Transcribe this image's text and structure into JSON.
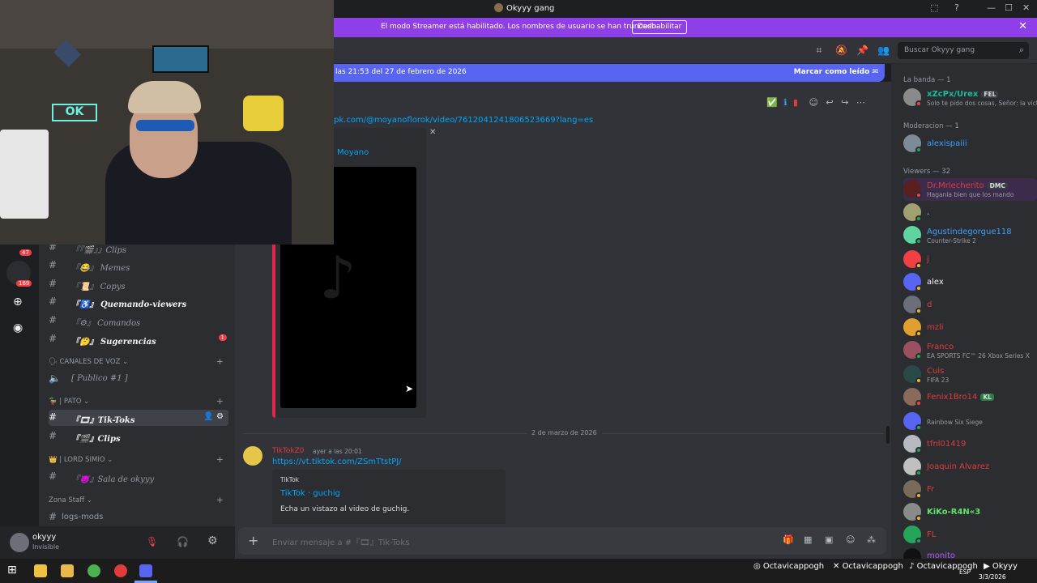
{
  "window": {
    "title": "Okyyy gang",
    "minimize": "—",
    "maximize": "☐",
    "close": "✕"
  },
  "banner": {
    "text": "El modo Streamer está habilitado. Los nombres de usuario se han truncado.",
    "button": "Deshabilitar",
    "accent": "#8f3fe8"
  },
  "search": {
    "placeholder": "Buscar Okyyy gang"
  },
  "new_messages": {
    "text": "las 21:53 del 27 de febrero de 2026",
    "mark_read": "Marcar como leído"
  },
  "messages": {
    "first": {
      "link": "pk.com/@moyanoflorok/video/7612041241806523669?lang=es",
      "embed_author": "Moyano"
    },
    "date_divider": "2 de marzo de 2026",
    "second": {
      "author": "TikTokZ0",
      "time": "ayer a las 20:01",
      "link": "https://vt.tiktok.com/ZSmTtstPJ/",
      "embed_provider": "TikTok",
      "embed_title": "TikTok · guchig",
      "embed_desc": "Echa un vistazo al video de guchig."
    }
  },
  "servers": {
    "badge1": "47",
    "badge2": "169"
  },
  "channels": {
    "items": [
      {
        "name": "Clips",
        "bracket": "『🎬』",
        "bold": false
      },
      {
        "name": "Memes",
        "bracket": "『😂』",
        "bold": false
      },
      {
        "name": "Copys",
        "bracket": "『📜』",
        "bold": false
      },
      {
        "name": "Quemando-viewers",
        "bracket": "『♿』",
        "bold": true
      },
      {
        "name": "Comandos",
        "bracket": "『⚙』",
        "bold": false
      },
      {
        "name": "Sugerencias",
        "bracket": "『🤔』",
        "bold": true,
        "badge": "1"
      }
    ],
    "voice_category": "CANALES DE VOZ",
    "voice_item": "[ Publico #1 ]",
    "pato_category": "PATO",
    "pato_items": [
      "Tik-Toks",
      "Clips"
    ],
    "simio_category": "LORD SIMIO",
    "simio_item": "Sala de okyyy",
    "staff_category": "Zona Staff",
    "staff_item": "logs-mods"
  },
  "user": {
    "name": "okyyy",
    "status": "Invisible"
  },
  "composer": {
    "placeholder": "Enviar mensaje a #『🎞』Tik-Toks"
  },
  "members": {
    "groups": [
      {
        "title": "La banda — 1"
      },
      {
        "title": "Moderacion — 1"
      },
      {
        "title": "Viewers — 32"
      }
    ],
    "banda": [
      {
        "name": "xZcPx/Urex",
        "tag": "FEL",
        "sub": "Solo te pido dos cosas, Señor: la vict",
        "color": "#1abc9c"
      }
    ],
    "moderacion": [
      {
        "name": "alexispaiii",
        "color": "#3ba1ff"
      }
    ],
    "viewers": [
      {
        "name": "Dr.Mrlecherito",
        "tag": "DMC",
        "sub": "Haganla bien que los mando",
        "color": "#e03c3c"
      },
      {
        "name": ".",
        "color": "#f2f3f5"
      },
      {
        "name": "Agustindegorgue118",
        "sub": "Counter-Strike 2",
        "color": "#3ba1ff"
      },
      {
        "name": "j",
        "color": "#e03c3c"
      },
      {
        "name": "alex",
        "color": "#f2f3f5"
      },
      {
        "name": "d",
        "color": "#e03c3c"
      },
      {
        "name": "mzli",
        "color": "#e03c3c"
      },
      {
        "name": "Franco",
        "sub": "EA SPORTS FC™ 26 Xbox Series X",
        "color": "#e03c3c"
      },
      {
        "name": "Cuis",
        "sub": "FIFA 23",
        "color": "#e03c3c"
      },
      {
        "name": "Fenix1Bro14",
        "tag": "KL",
        "color": "#e03c3c"
      },
      {
        "name": "",
        "sub": "Rainbow Six Siege",
        "color": "#e03c3c"
      },
      {
        "name": "tfnl01419",
        "color": "#e03c3c"
      },
      {
        "name": "Joaquin Alvarez",
        "color": "#e03c3c"
      },
      {
        "name": "Fr",
        "color": "#e03c3c"
      },
      {
        "name": "KiKo-R4N«3",
        "color": "#5ee36a"
      },
      {
        "name": "FL",
        "color": "#e03c3c"
      },
      {
        "name": "monito",
        "color": "#b05cff"
      }
    ]
  },
  "taskbar": {
    "socials": [
      "Octavicappogh",
      "Octavicappogh",
      "Octavicappogh",
      "Okyyy"
    ],
    "lang": "ESP",
    "date": "3/3/2026"
  }
}
